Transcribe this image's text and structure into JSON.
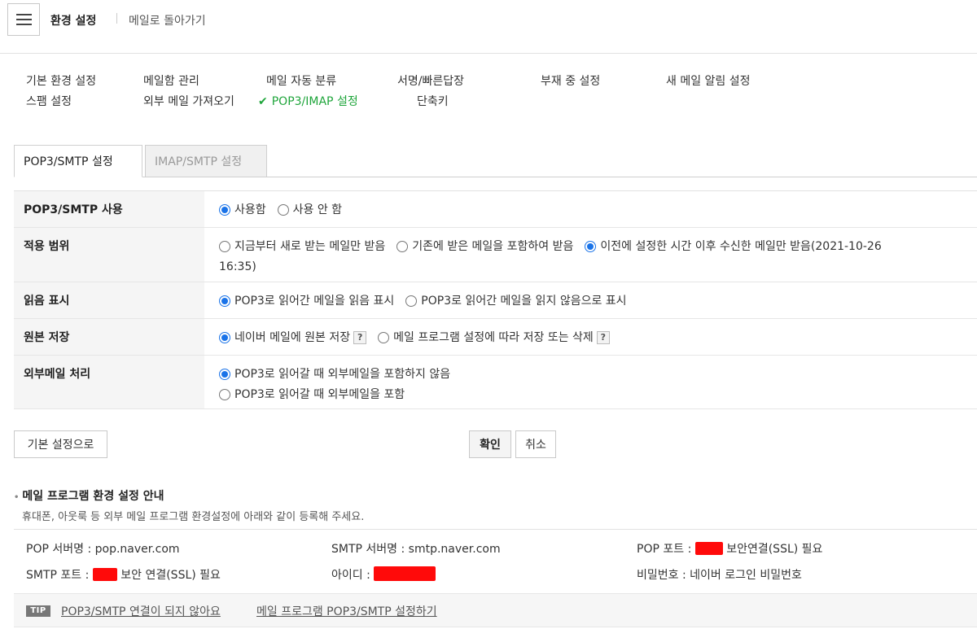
{
  "header": {
    "menu_icon": "hamburger-icon",
    "title": "환경 설정",
    "back_link": "메일로 돌아가기"
  },
  "nav": {
    "items": [
      {
        "label": "기본 환경 설정"
      },
      {
        "label": "메일함 관리"
      },
      {
        "label": "메일 자동 분류"
      },
      {
        "label": "서명/빠른답장"
      },
      {
        "label": "부재 중 설정"
      },
      {
        "label": "새 메일 알림 설정"
      },
      {
        "label": "스팸 설정"
      },
      {
        "label": "외부 메일 가져오기"
      },
      {
        "label": "POP3/IMAP 설정",
        "active": true
      },
      {
        "label": "단축키"
      }
    ],
    "active_icon": "✔",
    "active_color": "#1fa53b"
  },
  "tabs": [
    {
      "label": "POP3/SMTP 설정",
      "selected": true
    },
    {
      "label": "IMAP/SMTP 설정",
      "selected": false
    }
  ],
  "settings": {
    "use": {
      "label": "POP3/SMTP 사용",
      "options": [
        "사용함",
        "사용 안 함"
      ],
      "selected": 0
    },
    "scope": {
      "label": "적용 범위",
      "options": [
        "지금부터 새로 받는 메일만 받음",
        "기존에 받은 메일을 포함하여 받음",
        "이전에 설정한 시간 이후 수신한 메일만 받음(2021-10-26"
      ],
      "continuation": "16:35)",
      "selected": 2
    },
    "read_mark": {
      "label": "읽음 표시",
      "options": [
        "POP3로 읽어간 메일을 읽음 표시",
        "POP3로 읽어간 메일을 읽지 않음으로 표시"
      ],
      "selected": 0
    },
    "keep_original": {
      "label": "원본 저장",
      "options": [
        "네이버 메일에 원본 저장",
        "메일 프로그램 설정에 따라 저장 또는 삭제"
      ],
      "help": "?",
      "selected": 0
    },
    "external": {
      "label": "외부메일 처리",
      "options": [
        "POP3로 읽어갈 때 외부메일을 포함하지 않음",
        "POP3로 읽어갈 때 외부메일을 포함"
      ],
      "selected": 0
    }
  },
  "buttons": {
    "reset": "기본 설정으로",
    "confirm": "확인",
    "cancel": "취소"
  },
  "guide": {
    "title": "메일 프로그램 환경 설정 안내",
    "desc": "휴대폰, 아웃룩 등 외부 메일 프로그램 환경설정에 아래와 같이 등록해 주세요.",
    "pop_server": "POP 서버명 : pop.naver.com",
    "smtp_server": "SMTP 서버명 : smtp.naver.com",
    "pop_port_label": "POP 포트 :",
    "pop_port_suffix": "보안연결(SSL) 필요",
    "smtp_port_label": "SMTP 포트 :",
    "smtp_port_suffix": "보안 연결(SSL) 필요",
    "id_label": "아이디 :",
    "password": "비밀번호 : 네이버 로그인 비밀번호",
    "redaction_color": "#ff0a0a"
  },
  "tip": {
    "badge": "TIP",
    "links": [
      "POP3/SMTP 연결이 되지 않아요",
      "메일 프로그램 POP3/SMTP 설정하기"
    ]
  }
}
